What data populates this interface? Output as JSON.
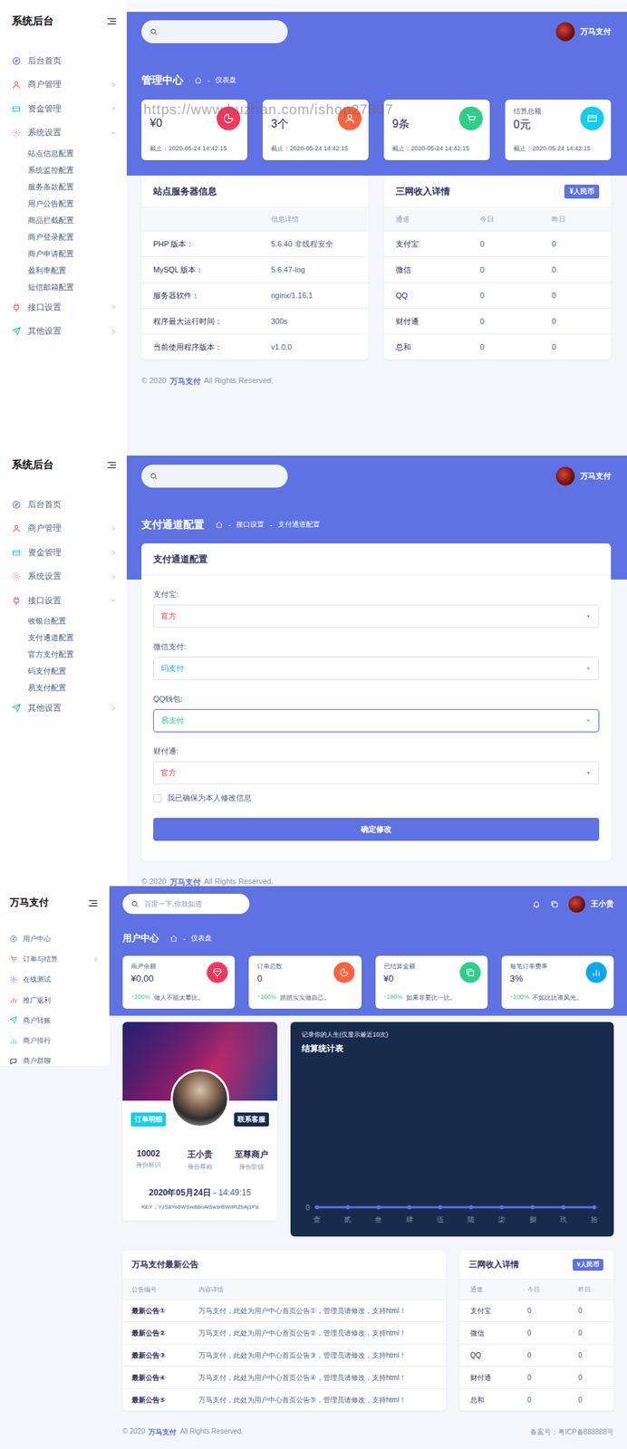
{
  "watermark": "https://www.huzhan.com/ishop27807",
  "dashboard": {
    "sidebar": {
      "title": "系统后台",
      "items": [
        {
          "label": "后台首页",
          "kind": "compass",
          "color": "#5e72e4",
          "has_children": false,
          "expanded": false,
          "children": []
        },
        {
          "label": "商户管理",
          "kind": "user",
          "color": "#fb6340",
          "has_children": true,
          "expanded": false,
          "children": []
        },
        {
          "label": "资金管理",
          "kind": "card",
          "color": "#11cdef",
          "has_children": true,
          "expanded": false,
          "children": []
        },
        {
          "label": "系统设置",
          "kind": "gear",
          "color": "#f3a4b5",
          "has_children": true,
          "expanded": true,
          "children": [
            "站点信息配置",
            "系统监控配置",
            "服务条款配置",
            "用户公告配置",
            "商品拦截配置",
            "商户登录配置",
            "商户申请配置",
            "盈利率配置",
            "短信邮箱配置"
          ]
        },
        {
          "label": "接口设置",
          "kind": "plug",
          "color": "#f5365c",
          "has_children": true,
          "expanded": false,
          "children": []
        },
        {
          "label": "其他设置",
          "kind": "send",
          "color": "#2dce89",
          "has_children": true,
          "expanded": false,
          "children": []
        }
      ]
    },
    "user_name": "万马支付",
    "page_title": "管理中心",
    "breadcrumb": {
      "separator": "-",
      "items": [
        "仪表盘"
      ]
    },
    "stat_cards": [
      {
        "value": "¥0",
        "note": "截止：2020-05-24 14:42:15",
        "kind": "pie",
        "color": "#f5365c"
      },
      {
        "value": "3个",
        "note": "截止：2020-05-24 14:42:15",
        "kind": "user",
        "color": "#fb6340"
      },
      {
        "value": "9条",
        "note": "截止：2020-05-24 14:42:15",
        "kind": "cart",
        "color": "#2dce89"
      },
      {
        "label": "结算总额",
        "value": "0元",
        "note": "截止：2020-05-24 14:42:15",
        "kind": "card",
        "color": "#11cdef"
      }
    ],
    "server_panel": {
      "title": "站点服务器信息",
      "detail_header": "信息详情",
      "rows": [
        [
          "PHP 版本：",
          "5.6.40 非线程安全"
        ],
        [
          "MySQL 版本：",
          "5.6.47-log"
        ],
        [
          "服务器软件：",
          "nginx/1.16.1"
        ],
        [
          "程序最大运行时间：",
          "300s"
        ],
        [
          "当前使用程序版本：",
          "v1.0.0"
        ]
      ]
    },
    "income_panel": {
      "title": "三网收入详情",
      "badge": "¥人民币",
      "columns": [
        "通道",
        "今日",
        "昨日"
      ],
      "rows": [
        [
          "支付宝",
          "0",
          "0"
        ],
        [
          "微信",
          "0",
          "0"
        ],
        [
          "QQ",
          "0",
          "0"
        ],
        [
          "财付通",
          "0",
          "0"
        ],
        [
          "总和",
          "0",
          "0"
        ]
      ]
    },
    "footer": {
      "year": "© 2020",
      "brand": "万马支付",
      "rights": "All Rights Reserved."
    }
  },
  "channels": {
    "sidebar": {
      "title": "系统后台",
      "items": [
        {
          "label": "后台首页",
          "kind": "compass",
          "color": "#5e72e4",
          "has_children": false,
          "expanded": false,
          "children": []
        },
        {
          "label": "商户管理",
          "kind": "user",
          "color": "#fb6340",
          "has_children": true,
          "expanded": false,
          "children": []
        },
        {
          "label": "资金管理",
          "kind": "card",
          "color": "#11cdef",
          "has_children": true,
          "expanded": false,
          "children": []
        },
        {
          "label": "系统设置",
          "kind": "gear",
          "color": "#f3a4b5",
          "has_children": true,
          "expanded": false,
          "children": []
        },
        {
          "label": "接口设置",
          "kind": "plug",
          "color": "#f5365c",
          "has_children": true,
          "expanded": true,
          "children": [
            "收银台配置",
            "支付通道配置",
            "官方支付配置",
            "码支付配置",
            "易支付配置"
          ]
        },
        {
          "label": "其他设置",
          "kind": "send",
          "color": "#2dce89",
          "has_children": true,
          "expanded": false,
          "children": []
        }
      ]
    },
    "user_name": "万马支付",
    "page_title": "支付通道配置",
    "breadcrumb": {
      "separator": "-",
      "items": [
        "接口设置",
        "支付通道配置"
      ]
    },
    "form": {
      "title": "支付通道配置",
      "fields": [
        {
          "label": "支付宝:",
          "value": "官方",
          "color": "#f5365c",
          "focused": false
        },
        {
          "label": "微信支付:",
          "value": "码支付",
          "color": "#11b8c9",
          "focused": false
        },
        {
          "label": "QQ钱包:",
          "value": "易支付",
          "color": "#2dce89",
          "focused": true
        },
        {
          "label": "财付通:",
          "value": "官方",
          "color": "#f5365c",
          "focused": false
        }
      ],
      "confirm": {
        "label": "我已确保为本人修改信息",
        "checked": false
      },
      "submit": "确定修改"
    },
    "footer": {
      "year": "© 2020",
      "brand": "万马支付",
      "rights": "All Rights Reserved."
    }
  },
  "user_center": {
    "sidebar": {
      "title": "万马支付",
      "items": [
        {
          "label": "用户中心",
          "kind": "compass",
          "color": "#5e72e4",
          "has_children": false
        },
        {
          "label": "订单与结算",
          "kind": "cart",
          "color": "#fb6340",
          "has_children": true
        },
        {
          "label": "在线测试",
          "kind": "gear",
          "color": "#8965e0",
          "has_children": false
        },
        {
          "label": "推广返利",
          "kind": "bars",
          "color": "#f5365c",
          "has_children": false
        },
        {
          "label": "商户转账",
          "kind": "send",
          "color": "#2dce89",
          "has_children": false
        },
        {
          "label": "商户排行",
          "kind": "bars",
          "color": "#11cdef",
          "has_children": false
        },
        {
          "label": "商户群聊",
          "kind": "chat",
          "color": "#172b4d",
          "has_children": false
        }
      ]
    },
    "search": {
      "placeholder": "百度一下,你就知道"
    },
    "user_name": "王小贵",
    "page_title": "用户中心",
    "breadcrumb": {
      "separator": "-",
      "items": [
        "仪表盘"
      ]
    },
    "stat_cards": [
      {
        "label": "商户余额",
        "value": "¥0.00",
        "trend": "↑100%",
        "note": "做人不能太攀比。",
        "kind": "gem",
        "color": "#f5365c"
      },
      {
        "label": "订单总数",
        "value": "0",
        "trend": "↑100%",
        "note": "踏踏实实做自己。",
        "kind": "pie",
        "color": "#fb6340"
      },
      {
        "label": "已结算金额",
        "value": "¥0",
        "trend": "↑100%",
        "note": "如果非要比一比。",
        "kind": "copy",
        "color": "#2dce89"
      },
      {
        "label": "每笔订单费率",
        "value": "3%",
        "trend": "↑100%",
        "note": "不如比比谁风光。",
        "kind": "bars",
        "color": "#11a5ef"
      }
    ],
    "profile": {
      "left_button": "订单明细",
      "right_button": "联系客服",
      "stats": [
        {
          "value": "10002",
          "label": "身份标识"
        },
        {
          "value": "王小贵",
          "label": "身份尊称"
        },
        {
          "value": "至尊商户",
          "label": "身份阶级"
        }
      ],
      "date": "2020年05月24日",
      "time": "- 14:49:15",
      "key": "KEY：YzS8Yo6WSw8BoAiSwsrBWdRZbAj1Pa"
    },
    "chart": {
      "caption": "记录你的人生(仅显示最近10次)",
      "title": "结算统计表",
      "y_ticks": [
        "0"
      ],
      "x_labels": [
        "壹",
        "贰",
        "叁",
        "肆",
        "伍",
        "陆",
        "柒",
        "捌",
        "玖",
        "拾"
      ],
      "series": [
        {
          "values": [
            0,
            0,
            0,
            0,
            0,
            0,
            0,
            0,
            0,
            0
          ]
        }
      ]
    },
    "notices": {
      "title": "万马支付最新公告",
      "columns": [
        "公告编号",
        "内容详情"
      ],
      "rows": [
        [
          "最新公告①",
          "万马支付，此处为用户中心首页公告①，管理员请修改，支持html！"
        ],
        [
          "最新公告②",
          "万马支付，此处为用户中心首页公告②，管理员请修改，支持html！"
        ],
        [
          "最新公告③",
          "万马支付，此处为用户中心首页公告③，管理员请修改，支持html！"
        ],
        [
          "最新公告④",
          "万马支付，此处为用户中心首页公告④，管理员请修改，支持html！"
        ],
        [
          "最新公告⑤",
          "万马支付，此处为用户中心首页公告⑤，管理员请修改，支持html！"
        ]
      ]
    },
    "income_panel": {
      "title": "三网收入详情",
      "badge": "¥人民币",
      "columns": [
        "通道",
        "今日",
        "昨日"
      ],
      "rows": [
        [
          "支付宝",
          "0",
          "0"
        ],
        [
          "微信",
          "0",
          "0"
        ],
        [
          "QQ",
          "0",
          "0"
        ],
        [
          "财付通",
          "0",
          "0"
        ],
        [
          "总和",
          "0",
          "0"
        ]
      ]
    },
    "footer": {
      "year": "© 2020",
      "brand": "万马支付",
      "rights": "All Rights Reserved.",
      "icp": "备案号：粤ICP备888888号"
    }
  }
}
